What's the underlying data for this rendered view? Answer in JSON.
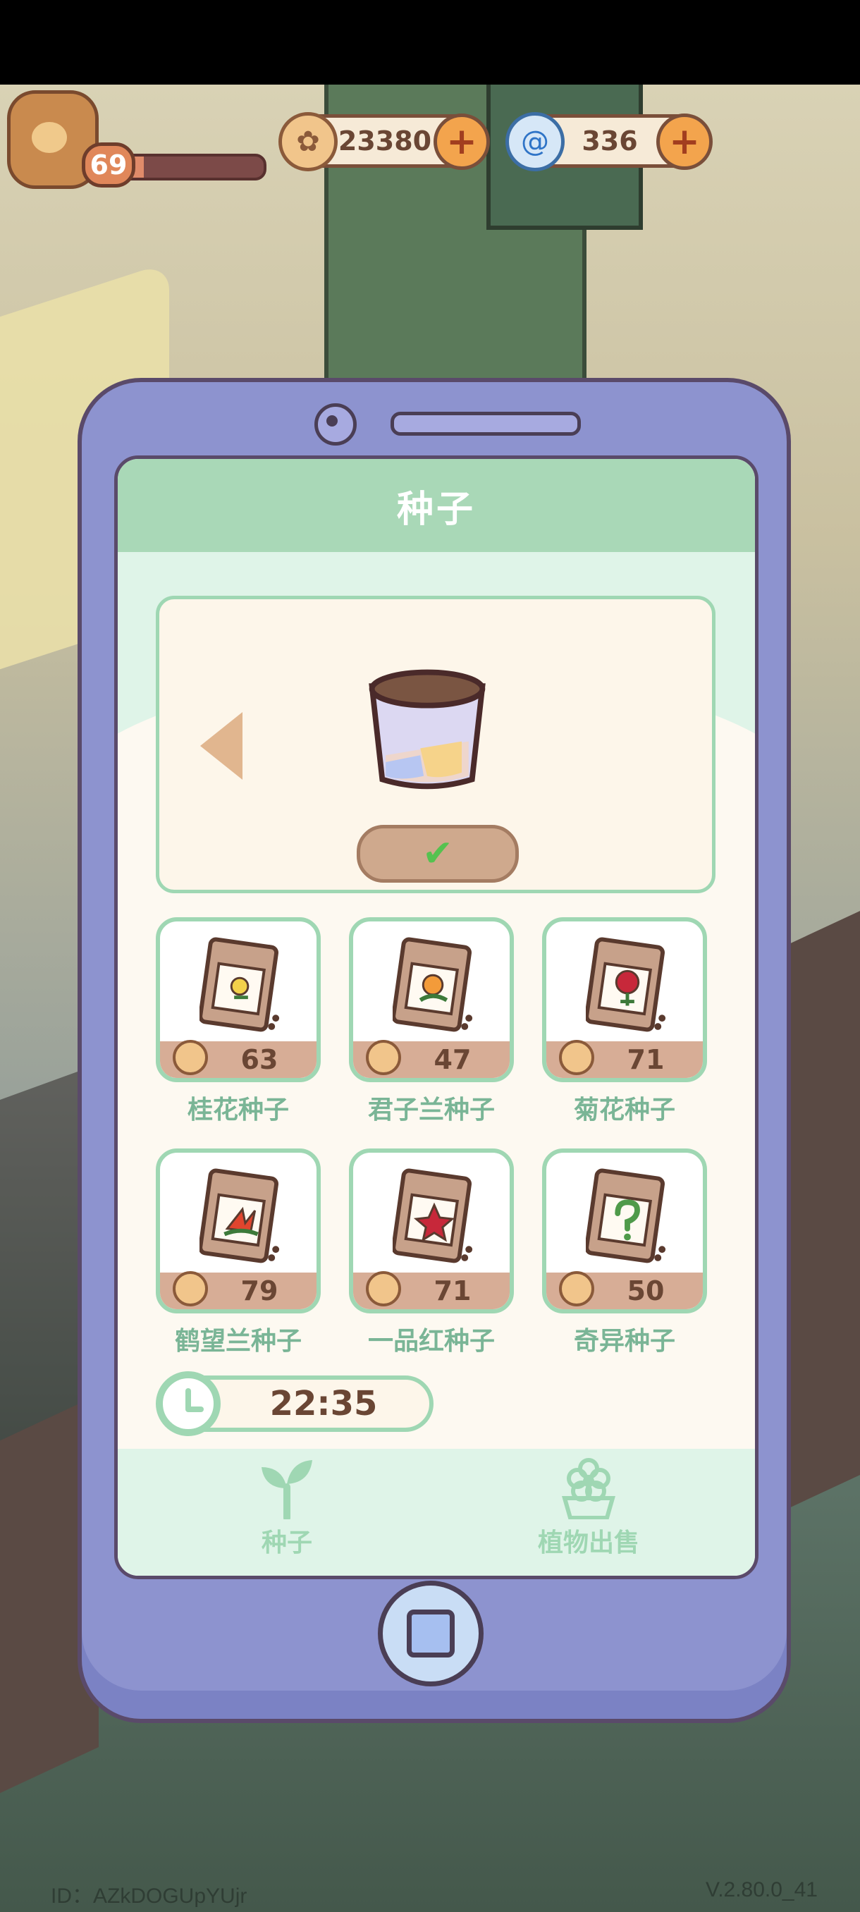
{
  "hud": {
    "player_level": "69",
    "level_progress": 0.15,
    "coins": "23380",
    "gems": "336"
  },
  "panel": {
    "title": "种子",
    "seeds": [
      {
        "name": "桂花种子",
        "price": "63",
        "flower": "yellow"
      },
      {
        "name": "君子兰种子",
        "price": "47",
        "flower": "orange"
      },
      {
        "name": "菊花种子",
        "price": "71",
        "flower": "red"
      },
      {
        "name": "鹤望兰种子",
        "price": "79",
        "flower": "bird-of-paradise"
      },
      {
        "name": "一品红种子",
        "price": "71",
        "flower": "poinsettia"
      },
      {
        "name": "奇异种子",
        "price": "50",
        "flower": "mystery"
      }
    ],
    "timer": "22:35"
  },
  "tabs": [
    {
      "label": "种子",
      "icon": "sprout-icon"
    },
    {
      "label": "植物出售",
      "icon": "flower-icon"
    }
  ],
  "footer": {
    "id": "ID：AZkDOGUpYUjr",
    "version": "V.2.80.0_41"
  },
  "colors": {
    "accent_green": "#9fd7b3",
    "phone_purple": "#8d93cf",
    "price_brown": "#6a4634"
  }
}
